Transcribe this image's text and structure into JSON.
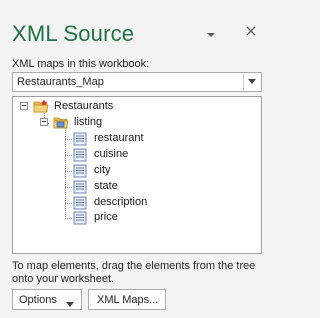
{
  "pane": {
    "title": "XML Source",
    "menu_icon": "chevron-down-icon",
    "close_icon": "close-icon",
    "accent_color": "#217346"
  },
  "maps": {
    "label": "XML maps in this workbook:",
    "selected": "Restaurants_Map"
  },
  "tree": {
    "root": {
      "label": "Restaurants",
      "icon": "root-element-icon"
    },
    "repeating": {
      "label": "listing",
      "icon": "repeating-element-folder-icon"
    },
    "fields": [
      {
        "label": "restaurant",
        "icon": "field-element-icon"
      },
      {
        "label": "cuisine",
        "icon": "field-element-icon"
      },
      {
        "label": "city",
        "icon": "field-element-icon"
      },
      {
        "label": "state",
        "icon": "field-element-icon"
      },
      {
        "label": "description",
        "icon": "field-element-icon"
      },
      {
        "label": "price",
        "icon": "field-element-icon"
      }
    ]
  },
  "footer": {
    "instructions": "To map elements, drag the elements from the tree onto your worksheet.",
    "options_label": "Options",
    "xml_maps_label": "XML Maps..."
  }
}
